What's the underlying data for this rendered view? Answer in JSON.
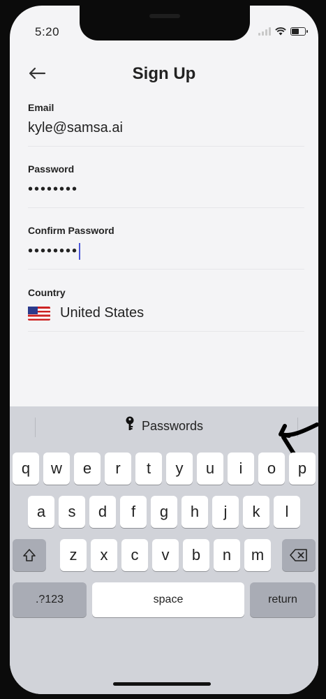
{
  "status_bar": {
    "time": "5:20",
    "signal_icon": "cellular-signal-icon",
    "wifi_icon": "wifi-icon",
    "battery_icon": "battery-icon"
  },
  "header": {
    "title": "Sign Up",
    "back_icon": "back-arrow-icon"
  },
  "form": {
    "email": {
      "label": "Email",
      "value": "kyle@samsa.ai"
    },
    "password": {
      "label": "Password",
      "value": "••••••••"
    },
    "confirm_password": {
      "label": "Confirm Password",
      "value": "••••••••"
    },
    "country": {
      "label": "Country",
      "value": "United States",
      "flag_icon": "us-flag-icon"
    }
  },
  "keyboard": {
    "suggestion": {
      "icon": "key-icon",
      "label": "Passwords"
    },
    "row1": [
      "q",
      "w",
      "e",
      "r",
      "t",
      "y",
      "u",
      "i",
      "o",
      "p"
    ],
    "row2": [
      "a",
      "s",
      "d",
      "f",
      "g",
      "h",
      "j",
      "k",
      "l"
    ],
    "row3": [
      "z",
      "x",
      "c",
      "v",
      "b",
      "n",
      "m"
    ],
    "shift_icon": "shift-icon",
    "delete_icon": "delete-icon",
    "numbers_label": ".?123",
    "space_label": "space",
    "return_label": "return"
  },
  "colors": {
    "caret": "#4a56d8",
    "keyboard_bg": "#d1d3d9",
    "accent_dark_key": "#a9acb5"
  }
}
